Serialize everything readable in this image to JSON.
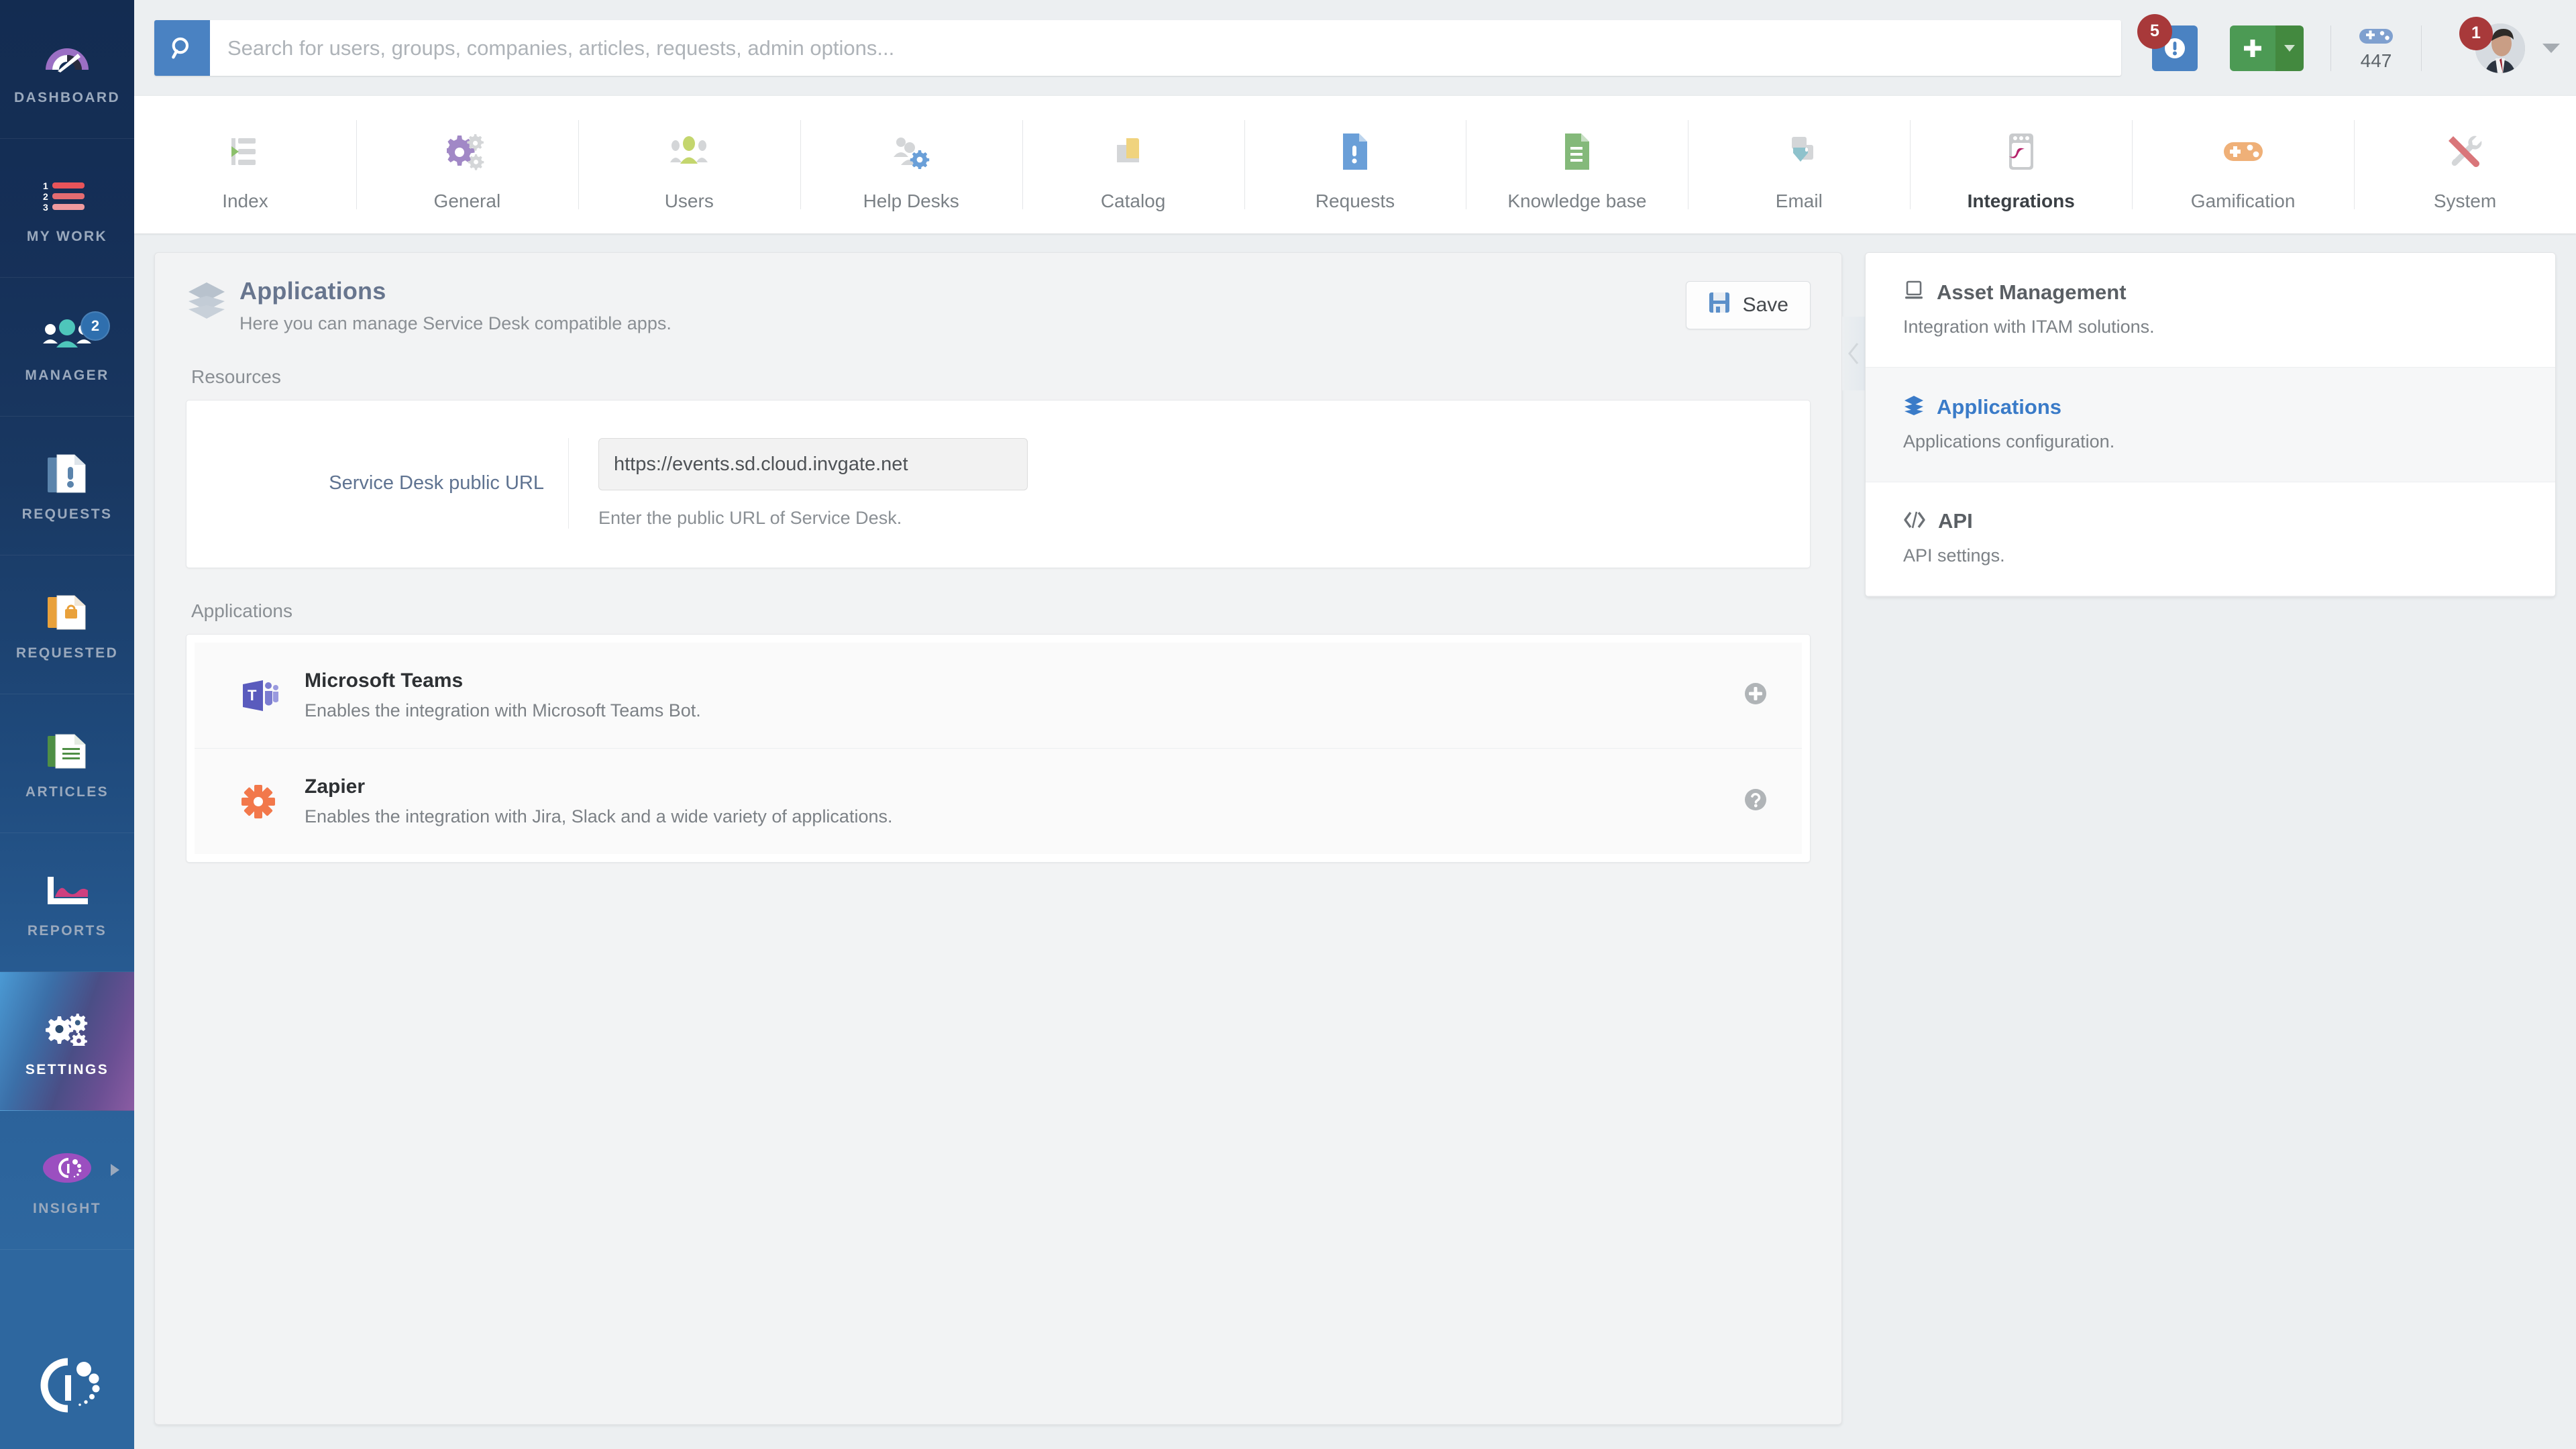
{
  "sidebar": {
    "items": [
      {
        "label": "DASHBOARD",
        "icon": "gauge-icon",
        "badge": null,
        "active": false,
        "arrow": false
      },
      {
        "label": "MY WORK",
        "icon": "numbered-list-icon",
        "badge": null,
        "active": false,
        "arrow": false
      },
      {
        "label": "MANAGER",
        "icon": "people-group-icon",
        "badge": "2",
        "active": false,
        "arrow": false
      },
      {
        "label": "REQUESTS",
        "icon": "request-document-icon",
        "badge": null,
        "active": false,
        "arrow": false
      },
      {
        "label": "REQUESTED",
        "icon": "requested-folder-icon",
        "badge": null,
        "active": false,
        "arrow": false
      },
      {
        "label": "ARTICLES",
        "icon": "article-document-icon",
        "badge": null,
        "active": false,
        "arrow": false
      },
      {
        "label": "REPORTS",
        "icon": "chart-report-icon",
        "badge": null,
        "active": false,
        "arrow": false
      },
      {
        "label": "SETTINGS",
        "icon": "gears-icon",
        "badge": null,
        "active": true,
        "arrow": false
      },
      {
        "label": "INSIGHT",
        "icon": "insight-logo-icon",
        "badge": null,
        "active": false,
        "arrow": true
      }
    ],
    "brand_logo": "invgate-logo-icon"
  },
  "topbar": {
    "search": {
      "placeholder": "Search for users, groups, companies, articles, requests, admin options...",
      "value": "",
      "icon": "search-icon"
    },
    "alerts": {
      "icon": "exclamation-icon",
      "count": "5"
    },
    "add_button": {
      "icon": "plus-icon",
      "caret_icon": "caret-down-icon"
    },
    "gamification": {
      "icon": "gamepad-icon",
      "points": "447"
    },
    "user": {
      "avatar": "user-avatar",
      "notifications": "1",
      "caret_icon": "caret-down-icon"
    }
  },
  "settings_tabs": [
    {
      "label": "Index",
      "icon": "index-list-icon",
      "active": false
    },
    {
      "label": "General",
      "icon": "gears-icon",
      "active": false
    },
    {
      "label": "Users",
      "icon": "users-icon",
      "active": false
    },
    {
      "label": "Help Desks",
      "icon": "helpdesk-gear-icon",
      "active": false
    },
    {
      "label": "Catalog",
      "icon": "folder-icon",
      "active": false
    },
    {
      "label": "Requests",
      "icon": "request-document-icon",
      "active": false
    },
    {
      "label": "Knowledge base",
      "icon": "kb-document-icon",
      "active": false
    },
    {
      "label": "Email",
      "icon": "email-icon",
      "active": false
    },
    {
      "label": "Integrations",
      "icon": "integrations-icon",
      "active": true
    },
    {
      "label": "Gamification",
      "icon": "gamepad-icon",
      "active": false
    },
    {
      "label": "System",
      "icon": "tools-icon",
      "active": false
    }
  ],
  "main": {
    "header": {
      "icon": "layers-icon",
      "title": "Applications",
      "subtitle": "Here you can manage Service Desk compatible apps.",
      "save_label": "Save",
      "save_icon": "floppy-disk-icon"
    },
    "resources": {
      "section_label": "Resources",
      "field_label": "Service Desk public URL",
      "field_value": "https://events.sd.cloud.invgate.net",
      "field_placeholder": "",
      "field_help": "Enter the public URL of Service Desk."
    },
    "applications": {
      "section_label": "Applications",
      "items": [
        {
          "icon": "microsoft-teams-icon",
          "name": "Microsoft Teams",
          "description": "Enables the integration with Microsoft Teams Bot.",
          "action_icon": "plus-circle-icon"
        },
        {
          "icon": "zapier-icon",
          "name": "Zapier",
          "description": "Enables the integration with Jira, Slack and a wide variety of applications.",
          "action_icon": "question-circle-icon"
        }
      ]
    }
  },
  "right_panel": {
    "collapse_icon": "chevron-left-icon",
    "items": [
      {
        "icon": "monitor-icon",
        "title": "Asset Management",
        "description": "Integration with ITAM solutions.",
        "active": false
      },
      {
        "icon": "layers-icon",
        "title": "Applications",
        "description": "Applications configuration.",
        "active": true
      },
      {
        "icon": "code-icon",
        "title": "API",
        "description": "API settings.",
        "active": false
      }
    ]
  },
  "colors": {
    "accent_blue": "#3a7bc8",
    "search_blue": "#4a82c2",
    "add_green": "#4c9a54",
    "badge_red": "#a8393a",
    "sidebar_badge": "#2f6fae",
    "panel_bg": "#f2f3f4",
    "page_bg": "#eceff1"
  }
}
